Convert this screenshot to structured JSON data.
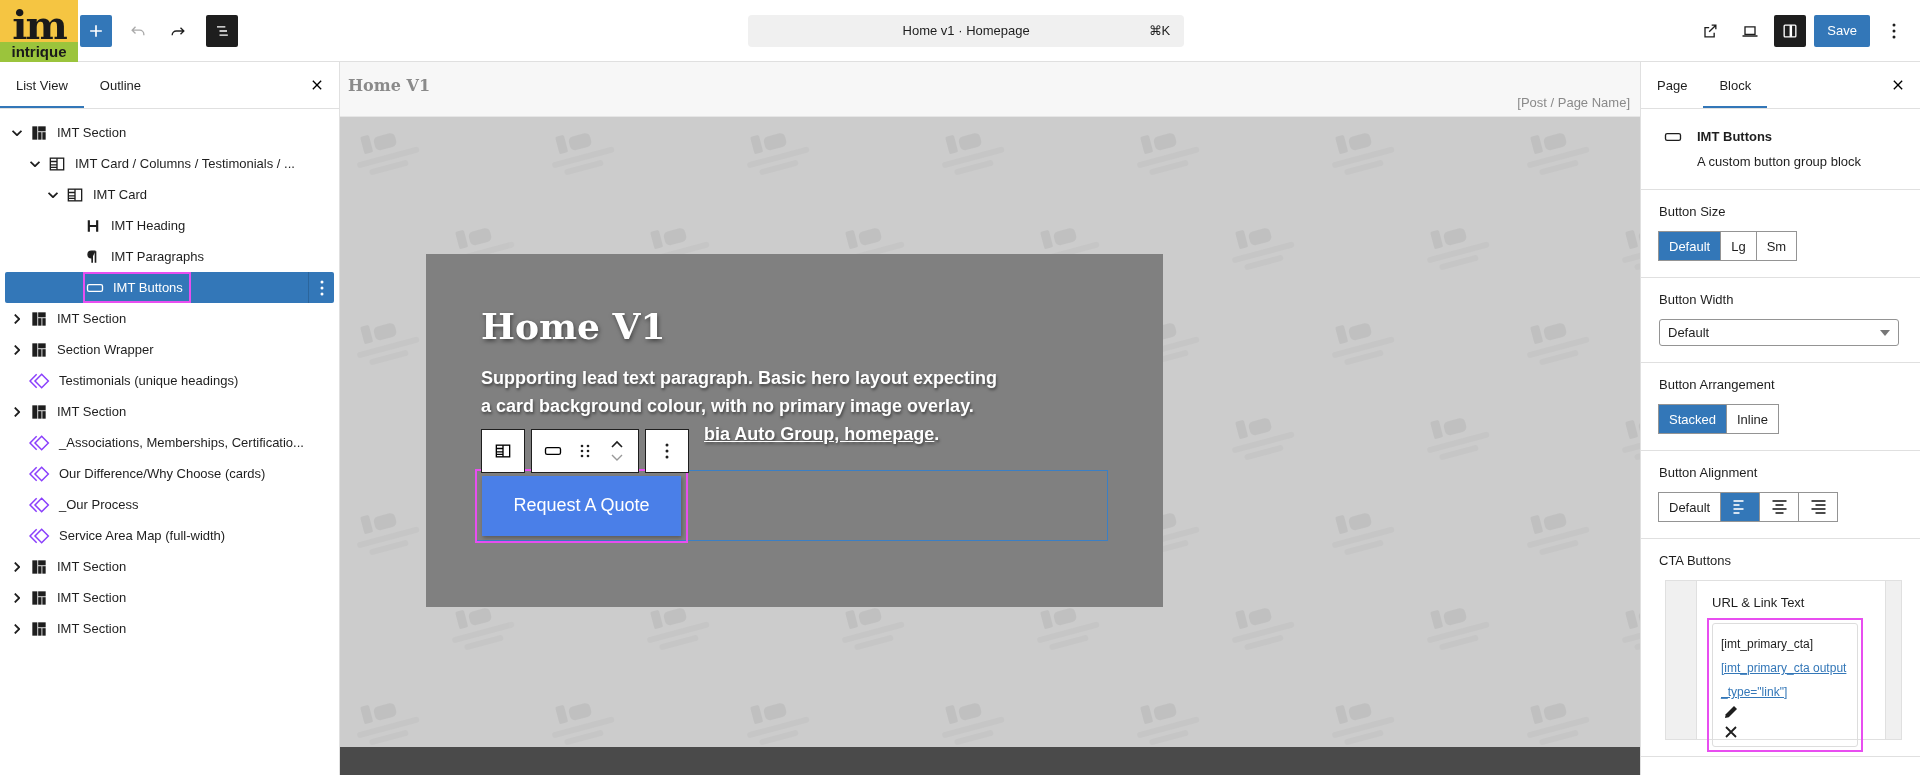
{
  "logo": {
    "mark": "im",
    "name": "intrique"
  },
  "toolbar": {
    "command_title": "Home v1 · Homepage",
    "shortcut": "⌘K",
    "save": "Save",
    "list_view_on": true,
    "sidebar_on": true
  },
  "left_panel": {
    "tabs": [
      {
        "label": "List View",
        "selected": true
      },
      {
        "label": "Outline",
        "selected": false
      }
    ],
    "tree": [
      {
        "label": "IMT Section",
        "kind": "section",
        "expanded": true,
        "selected": false,
        "highlighted": false,
        "children": [
          {
            "label": "IMT Card / Columns / Testimonials / ...",
            "kind": "columns",
            "expanded": true,
            "selected": false,
            "highlighted": false,
            "children": [
              {
                "label": "IMT Card",
                "kind": "columns",
                "expanded": true,
                "selected": false,
                "highlighted": false,
                "children": [
                  {
                    "label": "IMT Heading",
                    "kind": "heading",
                    "selected": false,
                    "highlighted": false
                  },
                  {
                    "label": "IMT Paragraphs",
                    "kind": "paragraph",
                    "selected": false,
                    "highlighted": false
                  },
                  {
                    "label": "IMT Buttons",
                    "kind": "buttons",
                    "selected": true,
                    "highlighted": true
                  }
                ]
              }
            ]
          }
        ]
      },
      {
        "label": "IMT Section",
        "kind": "section",
        "expanded": false,
        "selected": false,
        "highlighted": false
      },
      {
        "label": "Section Wrapper",
        "kind": "section",
        "expanded": false,
        "selected": false,
        "highlighted": false
      },
      {
        "label": "Testimonials (unique headings)",
        "kind": "pattern",
        "selected": false,
        "highlighted": false
      },
      {
        "label": "IMT Section",
        "kind": "section",
        "expanded": false,
        "selected": false,
        "highlighted": false
      },
      {
        "label": "_Associations, Memberships, Certificatio...",
        "kind": "pattern",
        "selected": false,
        "highlighted": false
      },
      {
        "label": "Our Difference/Why Choose (cards)",
        "kind": "pattern",
        "selected": false,
        "highlighted": false
      },
      {
        "label": "_Our Process",
        "kind": "pattern",
        "selected": false,
        "highlighted": false
      },
      {
        "label": "Service Area Map (full-width)",
        "kind": "pattern",
        "selected": false,
        "highlighted": false
      },
      {
        "label": "IMT Section",
        "kind": "section",
        "expanded": false,
        "selected": false,
        "highlighted": false
      },
      {
        "label": "IMT Section",
        "kind": "section",
        "expanded": false,
        "selected": false,
        "highlighted": false
      },
      {
        "label": "IMT Section",
        "kind": "section",
        "expanded": false,
        "selected": false,
        "highlighted": false
      }
    ]
  },
  "canvas": {
    "page_title": "Home V1",
    "page_name": "[Post / Page Name]",
    "hero": {
      "heading": "Home V1",
      "paragraph": "Supporting lead text paragraph. Basic hero layout expecting a card background colour, with no primary image overlay.",
      "link": "bia Auto Group, homepage",
      "link_tail": ".",
      "cta": "Request A Quote",
      "cta_highlighted": true
    }
  },
  "right_panel": {
    "tabs": [
      {
        "label": "Page",
        "selected": false
      },
      {
        "label": "Block",
        "selected": true
      }
    ],
    "block": {
      "title": "IMT Buttons",
      "description": "A custom button group block"
    },
    "sections": [
      {
        "kind": "segmented",
        "title": "Button Size",
        "options": [
          {
            "kind": "label",
            "label": "Default",
            "selected": true
          },
          {
            "kind": "label",
            "label": "Lg",
            "selected": false
          },
          {
            "kind": "label",
            "label": "Sm",
            "selected": false
          }
        ]
      },
      {
        "kind": "select",
        "title": "Button Width",
        "value": "Default"
      },
      {
        "kind": "segmented",
        "title": "Button Arrangement",
        "options": [
          {
            "kind": "label",
            "label": "Stacked",
            "selected": true
          },
          {
            "kind": "label",
            "label": "Inline",
            "selected": false
          }
        ]
      },
      {
        "kind": "segmented",
        "title": "Button Alignment",
        "options": [
          {
            "kind": "label",
            "label": "Default",
            "selected": false
          },
          {
            "kind": "align-left",
            "selected": true
          },
          {
            "kind": "align-center",
            "selected": false
          },
          {
            "kind": "align-right",
            "selected": false
          }
        ]
      },
      {
        "kind": "cta",
        "title": "CTA Buttons",
        "field_label": "URL & Link Text",
        "shortcode": "[imt_primary_cta]",
        "link": "[imt_primary_cta output_type=\"link\"]",
        "highlighted": true
      }
    ]
  }
}
